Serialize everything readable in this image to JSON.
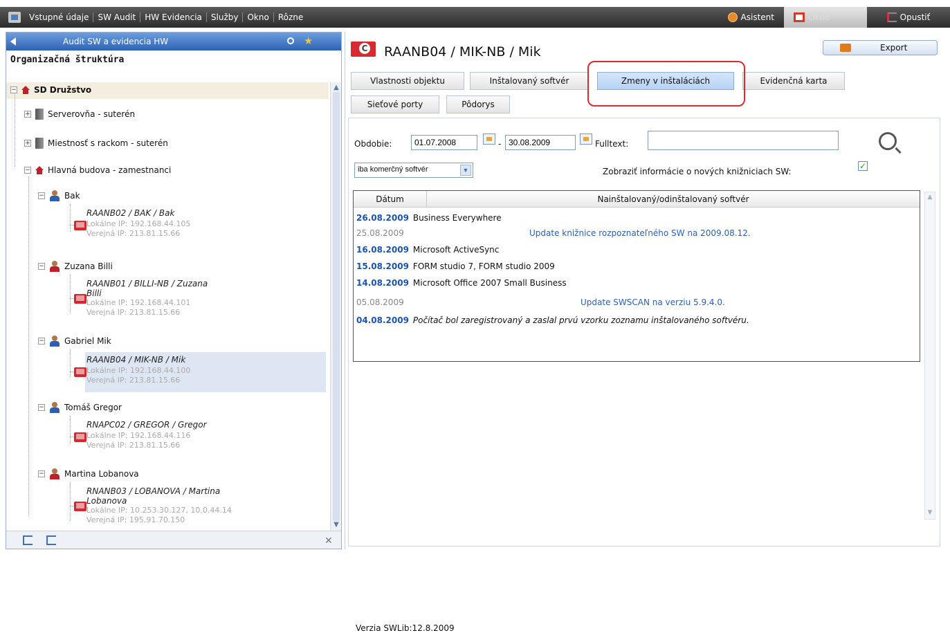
{
  "menubar": {
    "items": [
      "Vstupné údaje",
      "SW Audit",
      "HW Evidencia",
      "Služby",
      "Okno",
      "Rôzne"
    ],
    "asistent": "Asistent",
    "okno": "Okno",
    "opustit": "Opustiť"
  },
  "left": {
    "header": "Audit SW a evidencia HW",
    "section_title": "Organizačná štruktúra",
    "org": "SD Družstvo",
    "groups": [
      "Serverovňa - suterén",
      "Miestnosť s rackom - suterén",
      "Hlavná budova - zamestnanci"
    ],
    "people": [
      {
        "name": "Bak",
        "pc": "RAANB02 / BAK / Bak",
        "pc2": "",
        "lip": "Lokálne IP: 192.168.44.105",
        "vip": "Verejná IP: 213.81.15.66"
      },
      {
        "name": "Zuzana Billi",
        "pc": "RAANB01 / BILLI-NB / Zuzana",
        "pc2": "Billi",
        "lip": "Lokálne IP: 192.168.44.101",
        "vip": "Verejná IP: 213.81.15.66"
      },
      {
        "name": "Gabriel Mik",
        "pc": "RAANB04 / MIK-NB / Mik",
        "pc2": "",
        "lip": "Lokálne IP: 192.168.44.100",
        "vip": "Verejná IP: 213.81.15.66"
      },
      {
        "name": "Tomáš Gregor",
        "pc": "RNAPC02 / GREGOR / Gregor",
        "pc2": "",
        "lip": "Lokálne IP: 192.168.44.116",
        "vip": "Verejná IP: 213.81.15.66"
      },
      {
        "name": "Martina Lobanova",
        "pc": "RNANB03 / LOBANOVA / Martina",
        "pc2": "Lobanova",
        "lip": "Lokálne IP: 10.253.30.127, 10.0.44.14",
        "vip": "Verejná IP: 195.91.70.150"
      }
    ]
  },
  "right": {
    "title": "RAANB04 / MIK-NB / Mik",
    "export": "Export",
    "tabs": [
      "Vlastnosti objektu",
      "Inštalovaný softvér",
      "Zmeny v inštaláciách",
      "Evidenčná karta",
      "Sieťové porty",
      "Pôdorys"
    ],
    "filter": {
      "obdobie_label": "Obdobie:",
      "date_from": "01.07.2008",
      "dash": "-",
      "date_to": "30.08.2009",
      "fulltext_label": "Fulltext:",
      "fulltext_value": "",
      "select_value": "iba komerčný softvér",
      "lib_label": "Zobraziť informácie o nových knižniciach SW:"
    },
    "grid": {
      "col_date": "Dátum",
      "col_sw": "Nainštalovaný/odinštalovaný softvér",
      "rows": [
        {
          "date": "26.08.2009",
          "text": "Business Everywhere"
        },
        {
          "date": "25.08.2009",
          "note": "Update knižnice rozpoznateľného SW na 2009.08.12."
        },
        {
          "date": "16.08.2009",
          "text": "Microsoft ActiveSync"
        },
        {
          "date": "15.08.2009",
          "text": "FORM studio 7, FORM studio 2009"
        },
        {
          "date": "14.08.2009",
          "text": "Microsoft Office 2007 Small Business"
        },
        {
          "date": "05.08.2009",
          "note": "Update SWSCAN na verziu 5.9.4.0."
        },
        {
          "date": "04.08.2009",
          "text": "Počítač bol zaregistrovaný a zaslal prvú vzorku zoznamu inštalovaného softvéru."
        }
      ]
    },
    "version": "Verzia SWLib:12.8.2009"
  },
  "colors": {
    "menubar": "#2c2c2c",
    "accent": "#1a53b0",
    "highlight": "#e0282c"
  }
}
